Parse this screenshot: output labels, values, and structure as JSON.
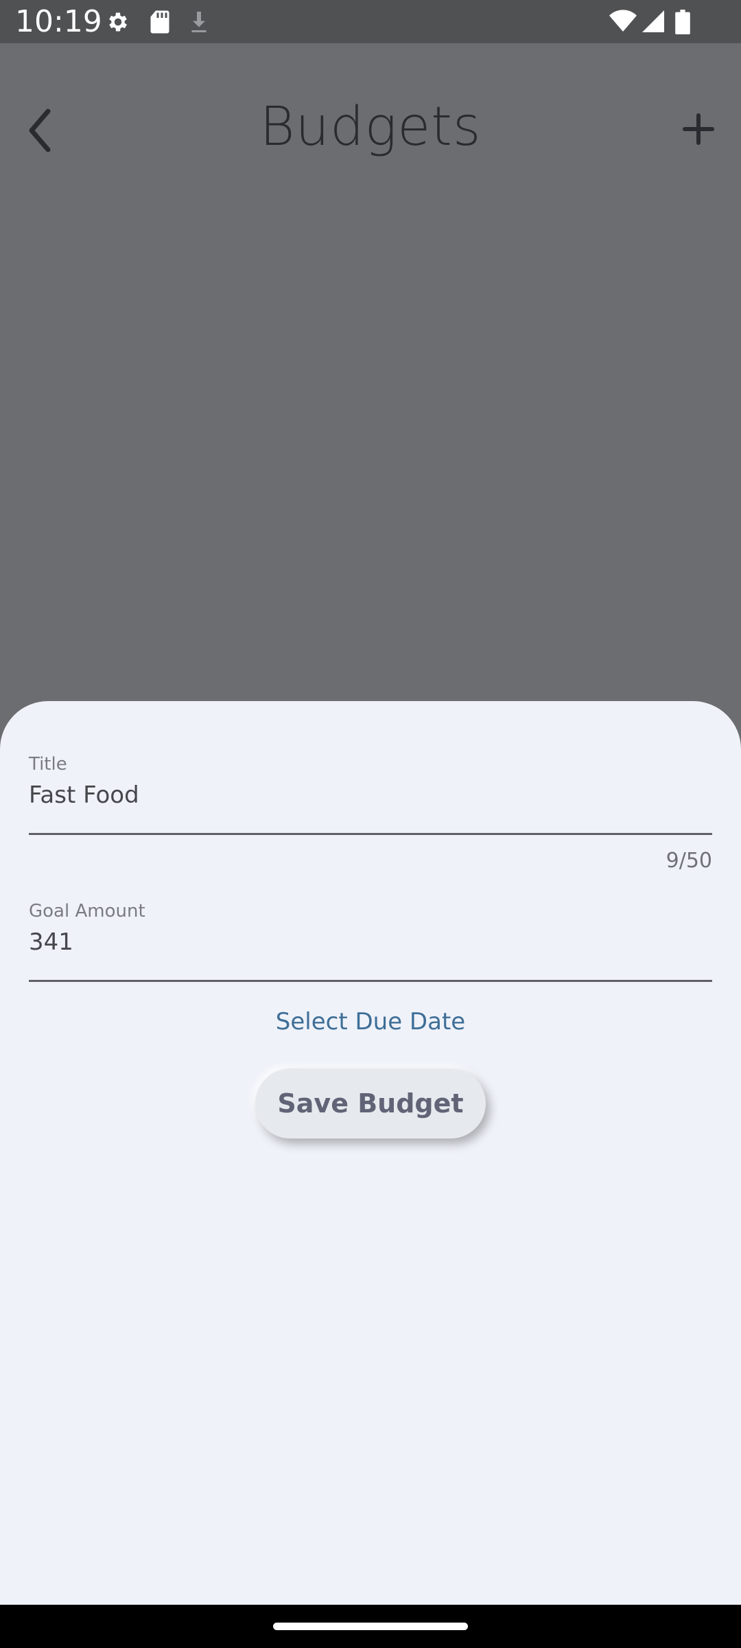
{
  "status_bar": {
    "time": "10:19",
    "icons": [
      "gear-icon",
      "sd-card-icon",
      "download-icon",
      "wifi-icon",
      "signal-icon",
      "battery-icon"
    ]
  },
  "header": {
    "title": "Budgets",
    "back_icon": "chevron-left-icon",
    "add_icon": "plus-icon"
  },
  "sheet": {
    "title_field": {
      "label": "Title",
      "value": "Fast Food",
      "counter": "9/50"
    },
    "goal_field": {
      "label": "Goal Amount",
      "value": "341"
    },
    "due_date_label": "Select Due Date",
    "save_label": "Save Budget"
  },
  "colors": {
    "scrim": "#6c6d70",
    "sheet_bg": "#eff2f9",
    "link": "#3e6e97",
    "button_bg": "#e6eaee",
    "button_text": "#616476"
  }
}
